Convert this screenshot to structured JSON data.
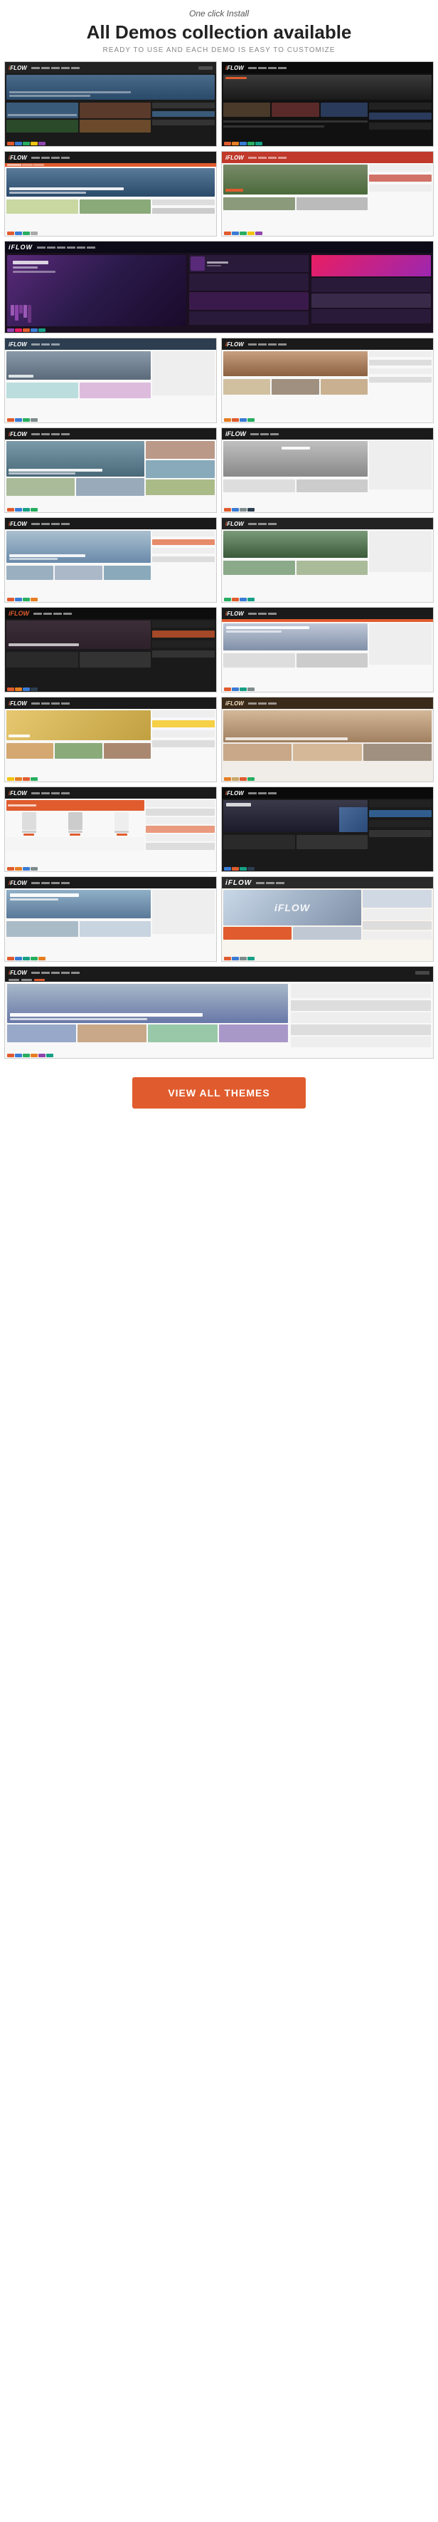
{
  "header": {
    "eyebrow": "One click Install",
    "title": "All Demos collection available",
    "description": "READY TO USE AND EACH DEMO IS EASY TO CUSTOMIZE"
  },
  "demos": [
    {
      "id": "demo-1",
      "type": "dark",
      "position": "left"
    },
    {
      "id": "demo-2",
      "type": "dark-red",
      "position": "right"
    },
    {
      "id": "demo-3",
      "type": "light",
      "position": "left"
    },
    {
      "id": "demo-4",
      "type": "red-accent",
      "position": "right"
    },
    {
      "id": "demo-5",
      "type": "music",
      "position": "full"
    },
    {
      "id": "demo-6",
      "type": "minimal",
      "position": "right"
    },
    {
      "id": "demo-7",
      "type": "magazine",
      "position": "left"
    },
    {
      "id": "demo-8",
      "type": "photo",
      "position": "right"
    },
    {
      "id": "demo-9",
      "type": "travel",
      "position": "left"
    },
    {
      "id": "demo-10",
      "type": "sport",
      "position": "right"
    },
    {
      "id": "demo-11",
      "type": "fitness",
      "position": "left"
    },
    {
      "id": "demo-12",
      "type": "food",
      "position": "right"
    },
    {
      "id": "demo-13",
      "type": "shop",
      "position": "left"
    },
    {
      "id": "demo-14",
      "type": "news",
      "position": "right"
    },
    {
      "id": "demo-15",
      "type": "blog",
      "position": "full"
    }
  ],
  "cta": {
    "label": "View all Themes"
  }
}
